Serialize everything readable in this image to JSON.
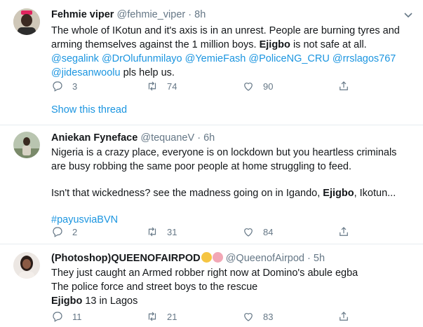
{
  "tweets": [
    {
      "name": "Fehmie viper",
      "handle": "@fehmie_viper",
      "dot": "·",
      "time": "8h",
      "text": {
        "p1": "The whole of IKotun and it's axis is in an unrest. People are burning tyres and arming themselves against the 1 million boys.",
        "bold": "Ejigbo",
        "p2": "is not safe at all.",
        "mentions": [
          "@segalink",
          "@DrOlufunmilayo",
          "@YemieFash",
          "@PoliceNG_CRU",
          "@rrslagos767",
          "@jidesanwoolu"
        ],
        "tail": "pls help us."
      },
      "replies": "3",
      "retweets": "74",
      "likes": "90",
      "show_thread": "Show this thread"
    },
    {
      "name": "Aniekan Fyneface",
      "handle": "@tequaneV",
      "dot": "·",
      "time": "6h",
      "text": {
        "p1": "Nigeria is a crazy place, everyone is on lockdown but you heartless criminals are busy robbing the same poor people at home struggling to feed.",
        "p2a": "Isn't that wickedness? see the madness going on in Igando,",
        "bold": "Ejigbo",
        "p2b": ", Ikotun...",
        "hashtag": "#payusviaBVN"
      },
      "replies": "2",
      "retweets": "31",
      "likes": "84"
    },
    {
      "name": "(Photoshop)QUEENOFAIRPOD",
      "handle": "@QueenofAirpod",
      "dot": "·",
      "time": "5h",
      "text": {
        "l1": "They just caught an Armed robber right now at Domino's abule egba",
        "l2": "The police force and street boys to the rescue",
        "bold": "Ejigbo",
        "l3": "13 in Lagos"
      },
      "replies": "11",
      "retweets": "21",
      "likes": "83"
    }
  ],
  "colors": {
    "link": "#1b95e0",
    "muted": "#657786",
    "text": "#14171a",
    "divider": "#e6ecf0"
  }
}
